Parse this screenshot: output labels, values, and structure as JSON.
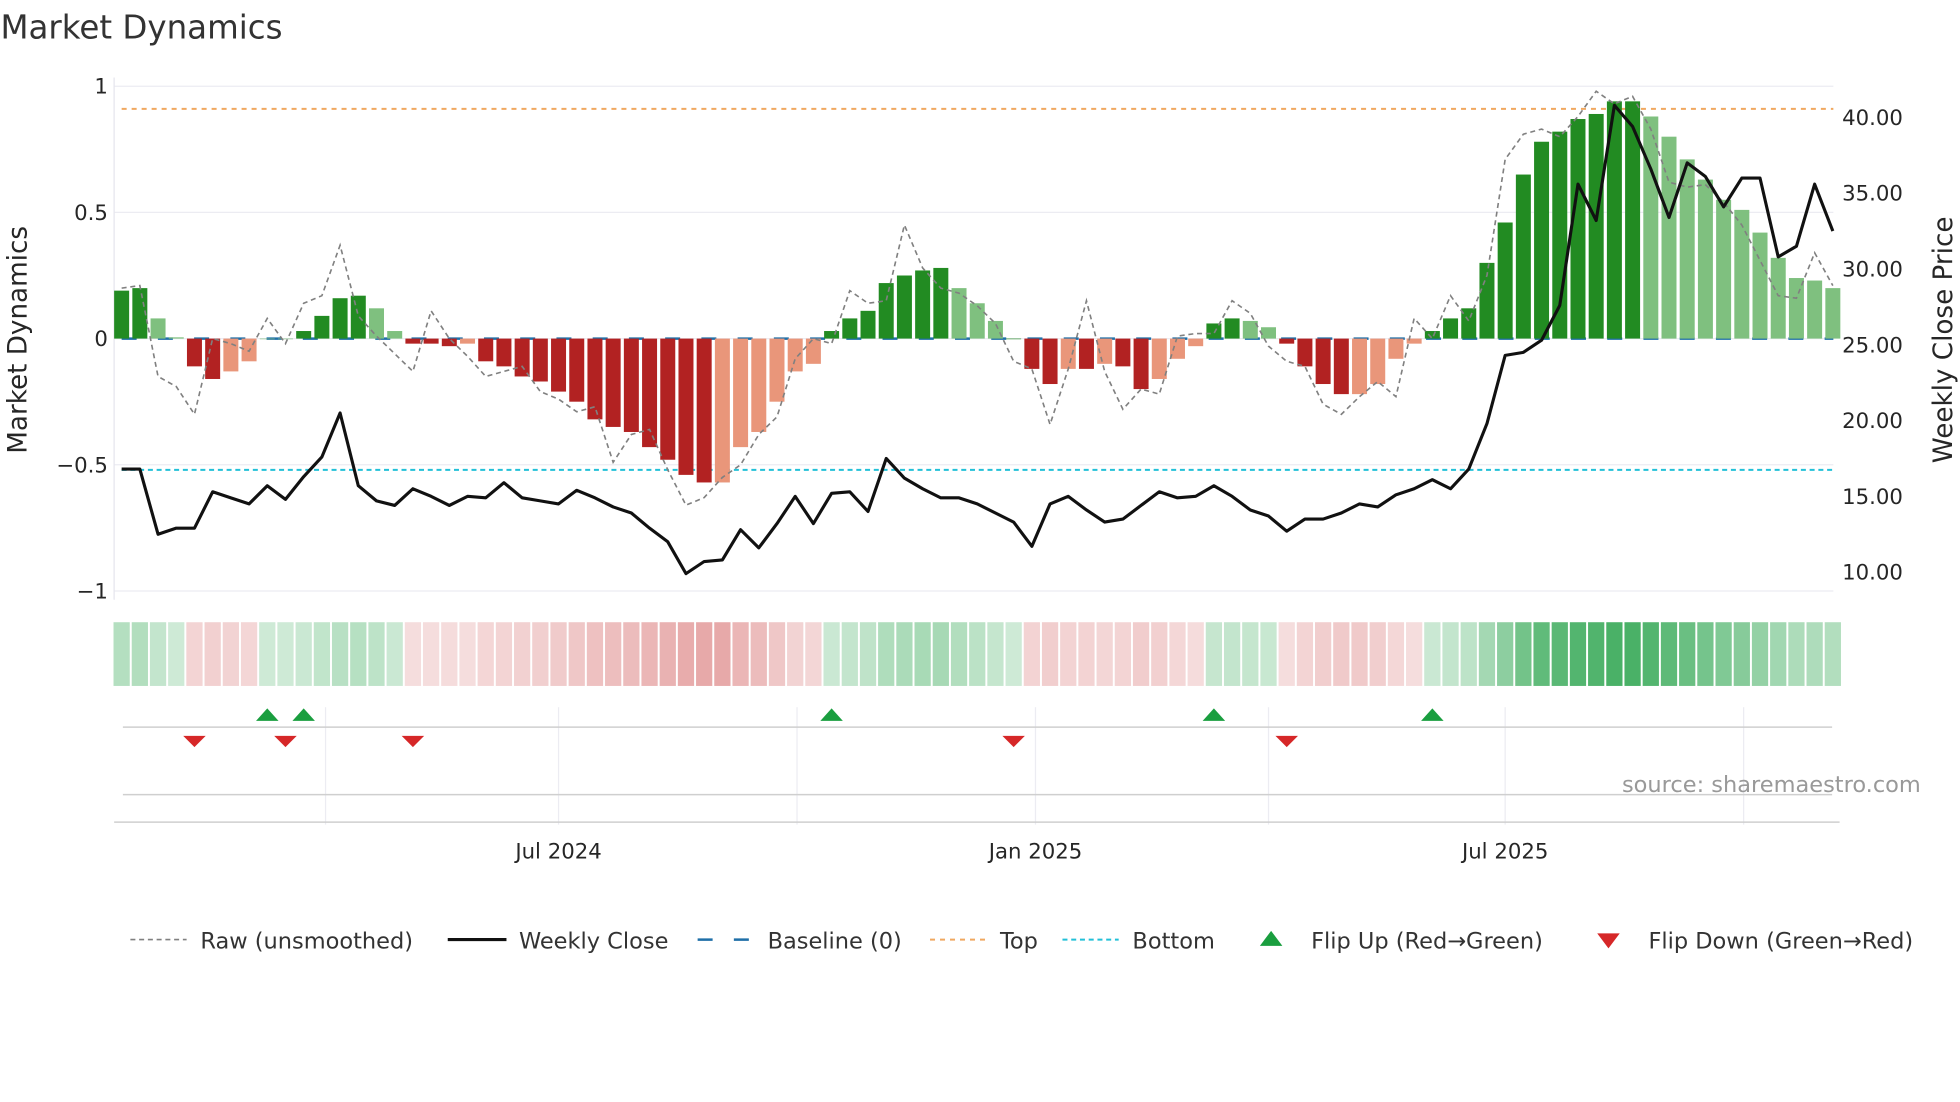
{
  "chart_data": {
    "type": "bar",
    "title": "Market Dynamics",
    "ylabel": "Market Dynamics",
    "y2label": "Weekly Close Price",
    "ylim": [
      -1.05,
      1.0
    ],
    "y2lim": [
      8.5,
      42.5
    ],
    "yticks": [
      {
        "v": 1,
        "label": "1"
      },
      {
        "v": 0.5,
        "label": "0.5"
      },
      {
        "v": 0,
        "label": "0"
      },
      {
        "v": -0.5,
        "label": "−0.5"
      },
      {
        "v": -1,
        "label": "−1"
      }
    ],
    "y2ticks": [
      {
        "v": 40,
        "label": "40.00"
      },
      {
        "v": 35,
        "label": "35.00"
      },
      {
        "v": 30,
        "label": "30.00"
      },
      {
        "v": 25,
        "label": "25.00"
      },
      {
        "v": 20,
        "label": "20.00"
      },
      {
        "v": 15,
        "label": "15.00"
      },
      {
        "v": 10,
        "label": "10.00"
      }
    ],
    "xticks": [
      {
        "week": 25,
        "label": "Jul 2024"
      },
      {
        "week": 51.2,
        "label": "Jan 2025"
      },
      {
        "week": 77,
        "label": "Jul 2025"
      }
    ],
    "quarter_gridlines_week": [
      12.2,
      25,
      38.1,
      51.2,
      64,
      77,
      90.1
    ],
    "top_level": 0.91,
    "bottom_level": -0.52,
    "baseline": 0,
    "smoothed": [
      0.19,
      0.2,
      0.08,
      0.005,
      -0.11,
      -0.16,
      -0.13,
      -0.09,
      0,
      0,
      0.03,
      0.09,
      0.16,
      0.17,
      0.12,
      0.03,
      -0.02,
      -0.02,
      -0.03,
      -0.02,
      -0.09,
      -0.11,
      -0.15,
      -0.17,
      -0.21,
      -0.25,
      -0.32,
      -0.35,
      -0.37,
      -0.43,
      -0.48,
      -0.54,
      -0.57,
      -0.57,
      -0.43,
      -0.37,
      -0.25,
      -0.13,
      -0.1,
      0.03,
      0.08,
      0.11,
      0.22,
      0.25,
      0.27,
      0.28,
      0.2,
      0.14,
      0.07,
      0,
      -0.12,
      -0.18,
      -0.12,
      -0.12,
      -0.1,
      -0.11,
      -0.2,
      -0.16,
      -0.08,
      -0.03,
      0.06,
      0.08,
      0.07,
      0.045,
      -0.02,
      -0.11,
      -0.18,
      -0.22,
      -0.22,
      -0.18,
      -0.08,
      -0.02,
      0.03,
      0.08,
      0.12,
      0.3,
      0.46,
      0.65,
      0.78,
      0.82,
      0.87,
      0.89,
      0.94,
      0.94,
      0.88,
      0.8,
      0.71,
      0.63,
      0.55,
      0.51,
      0.42,
      0.32,
      0.24,
      0.23,
      0.2
    ],
    "bar_state": "GGggRRrrggGGGGggRRRrRRRRRRRRRRRRRrrrrrrGGGGGGGgggGRRrRrRRrrrGGggRRRRrrrrGGGGGGGGGGGGggggggggggg",
    "raw": [
      0.2,
      0.21,
      -0.15,
      -0.19,
      -0.3,
      0,
      -0.02,
      -0.05,
      0.08,
      -0.02,
      0.14,
      0.17,
      0.37,
      0.09,
      0.01,
      -0.06,
      -0.13,
      0.11,
      0,
      -0.07,
      -0.15,
      -0.13,
      -0.11,
      -0.21,
      -0.24,
      -0.29,
      -0.27,
      -0.49,
      -0.38,
      -0.36,
      -0.52,
      -0.66,
      -0.63,
      -0.55,
      -0.5,
      -0.38,
      -0.31,
      -0.08,
      0,
      -0.02,
      0.19,
      0.14,
      0.15,
      0.45,
      0.28,
      0.2,
      0.18,
      0.13,
      0.06,
      -0.09,
      -0.12,
      -0.34,
      -0.12,
      0.15,
      -0.13,
      -0.28,
      -0.2,
      -0.22,
      0.01,
      0.02,
      0.02,
      0.15,
      0.1,
      -0.03,
      -0.09,
      -0.11,
      -0.26,
      -0.3,
      -0.23,
      -0.17,
      -0.23,
      0.08,
      0,
      0.17,
      0.07,
      0.25,
      0.71,
      0.81,
      0.83,
      0.8,
      0.88,
      0.98,
      0.93,
      0.96,
      0.83,
      0.62,
      0.6,
      0.61,
      0.54,
      0.45,
      0.31,
      0.17,
      0.16,
      0.34,
      0.21
    ],
    "close": [
      16.8,
      16.8,
      12.5,
      12.9,
      12.9,
      15.3,
      14.9,
      14.5,
      15.7,
      14.8,
      16.3,
      17.6,
      20.5,
      15.7,
      14.7,
      14.4,
      15.5,
      15.0,
      14.4,
      15.0,
      14.9,
      15.9,
      14.9,
      14.7,
      14.5,
      15.4,
      14.9,
      14.3,
      13.9,
      12.9,
      12.0,
      9.9,
      10.7,
      10.8,
      12.8,
      11.6,
      13.2,
      15.0,
      13.2,
      15.2,
      15.3,
      14.0,
      17.5,
      16.2,
      15.5,
      14.9,
      14.9,
      14.5,
      13.9,
      13.3,
      11.7,
      14.5,
      15.0,
      14.1,
      13.3,
      13.5,
      14.4,
      15.3,
      14.9,
      15.0,
      15.7,
      15.0,
      14.1,
      13.7,
      12.7,
      13.5,
      13.5,
      13.9,
      14.5,
      14.3,
      15.1,
      15.5,
      16.1,
      15.5,
      16.8,
      19.8,
      24.3,
      24.5,
      25.3,
      27.6,
      35.6,
      33.2,
      40.8,
      39.4,
      36.6,
      33.4,
      37.0,
      36.1,
      34.1,
      36.0,
      36.0,
      30.8,
      31.5,
      35.6,
      32.5
    ],
    "flip_up_weeks": [
      9,
      11,
      40,
      61,
      73
    ],
    "flip_down_weeks": [
      5,
      10,
      17,
      50,
      65
    ],
    "legend": [
      {
        "key": "raw",
        "label": "Raw (unsmoothed)"
      },
      {
        "key": "close",
        "label": "Weekly Close"
      },
      {
        "key": "baseline",
        "label": "Baseline (0)"
      },
      {
        "key": "top",
        "label": "Top"
      },
      {
        "key": "bottom",
        "label": "Bottom"
      },
      {
        "key": "up",
        "label": "Flip Up (Red→Green)"
      },
      {
        "key": "down",
        "label": "Flip Down (Green→Red)"
      }
    ],
    "source": "source: sharemaestro.com",
    "colors": {
      "strong_green": "#228b22",
      "weak_green": "#7fc07f",
      "strong_red": "#b22222",
      "weak_red": "#e9967a",
      "raw": "#808080",
      "close": "#111111",
      "baseline": "#1f6fa8",
      "top": "#f0a860",
      "bottom": "#22c0d8",
      "up": "#1a9e3f",
      "down": "#d62728"
    }
  }
}
